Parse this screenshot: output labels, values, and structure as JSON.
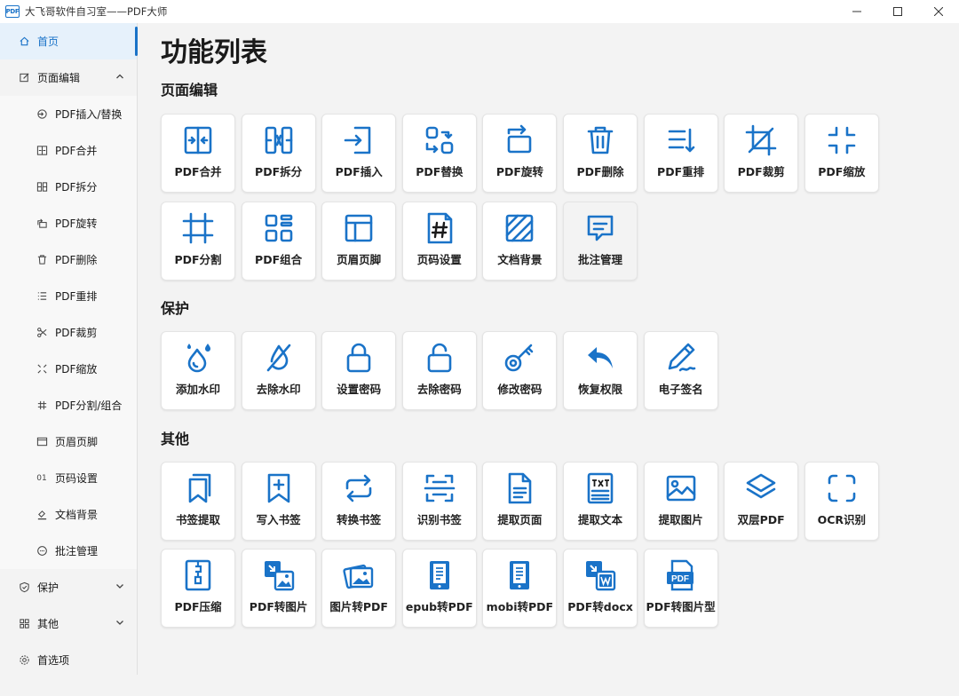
{
  "window": {
    "logo_text": "PDF",
    "title": "大飞哥软件自习室——PDF大师",
    "minimize": "—",
    "maximize": "☐",
    "close": "✕"
  },
  "sidebar": {
    "items": [
      {
        "id": "home",
        "label": "首页",
        "icon": "home-icon",
        "active": true,
        "level": 0
      },
      {
        "id": "page-edit",
        "label": "页面编辑",
        "icon": "edit-icon",
        "level": 0,
        "chevron": "up"
      },
      {
        "id": "pdf-insert-replace",
        "label": "PDF插入/替换",
        "icon": "insert-replace-icon",
        "level": 1
      },
      {
        "id": "pdf-merge",
        "label": "PDF合并",
        "icon": "merge-icon",
        "level": 1
      },
      {
        "id": "pdf-split",
        "label": "PDF拆分",
        "icon": "split-icon",
        "level": 1
      },
      {
        "id": "pdf-rotate",
        "label": "PDF旋转",
        "icon": "rotate-icon",
        "level": 1
      },
      {
        "id": "pdf-delete",
        "label": "PDF删除",
        "icon": "trash-icon",
        "level": 1
      },
      {
        "id": "pdf-reorder",
        "label": "PDF重排",
        "icon": "list-icon",
        "level": 1
      },
      {
        "id": "pdf-crop",
        "label": "PDF裁剪",
        "icon": "scissors-icon",
        "level": 1
      },
      {
        "id": "pdf-scale",
        "label": "PDF缩放",
        "icon": "shrink-icon",
        "level": 1
      },
      {
        "id": "pdf-split-combine",
        "label": "PDF分割/组合",
        "icon": "hash-icon",
        "level": 1
      },
      {
        "id": "header-footer",
        "label": "页眉页脚",
        "icon": "header-footer-icon",
        "level": 1
      },
      {
        "id": "page-number",
        "label": "页码设置",
        "icon": "page-number-icon",
        "level": 1,
        "glyph": "01"
      },
      {
        "id": "doc-background",
        "label": "文档背景",
        "icon": "paint-bucket-icon",
        "level": 1
      },
      {
        "id": "annotation",
        "label": "批注管理",
        "icon": "comment-icon",
        "level": 1
      },
      {
        "id": "protect",
        "label": "保护",
        "icon": "shield-icon",
        "level": 0,
        "chevron": "down"
      },
      {
        "id": "other",
        "label": "其他",
        "icon": "grid-icon",
        "level": 0,
        "chevron": "down"
      },
      {
        "id": "preferences",
        "label": "首选项",
        "icon": "gear-icon",
        "level": 0
      }
    ]
  },
  "main": {
    "title": "功能列表",
    "sections": [
      {
        "id": "page-edit",
        "title": "页面编辑",
        "rows": [
          [
            {
              "label": "PDF合并",
              "icon": "merge"
            },
            {
              "label": "PDF拆分",
              "icon": "split"
            },
            {
              "label": "PDF插入",
              "icon": "insert"
            },
            {
              "label": "PDF替换",
              "icon": "replace"
            },
            {
              "label": "PDF旋转",
              "icon": "rotate"
            },
            {
              "label": "PDF删除",
              "icon": "trash"
            },
            {
              "label": "PDF重排",
              "icon": "reorder"
            },
            {
              "label": "PDF裁剪",
              "icon": "crop"
            },
            {
              "label": "PDF缩放",
              "icon": "shrink"
            }
          ],
          [
            {
              "label": "PDF分割",
              "icon": "hash-frame"
            },
            {
              "label": "PDF组合",
              "icon": "combine"
            },
            {
              "label": "页眉页脚",
              "icon": "layout"
            },
            {
              "label": "页码设置",
              "icon": "page-hash"
            },
            {
              "label": "文档背景",
              "icon": "stripes"
            },
            {
              "label": "批注管理",
              "icon": "comment",
              "hover": true
            }
          ]
        ]
      },
      {
        "id": "protect",
        "title": "保护",
        "rows": [
          [
            {
              "label": "添加水印",
              "icon": "drop"
            },
            {
              "label": "去除水印",
              "icon": "drop-off"
            },
            {
              "label": "设置密码",
              "icon": "lock"
            },
            {
              "label": "去除密码",
              "icon": "unlock"
            },
            {
              "label": "修改密码",
              "icon": "key"
            },
            {
              "label": "恢复权限",
              "icon": "undo"
            },
            {
              "label": "电子签名",
              "icon": "pen"
            }
          ]
        ]
      },
      {
        "id": "other",
        "title": "其他",
        "rows": [
          [
            {
              "label": "书签提取",
              "icon": "bookmarks"
            },
            {
              "label": "写入书签",
              "icon": "bookmark-add"
            },
            {
              "label": "转换书签",
              "icon": "repeat"
            },
            {
              "label": "识别书签",
              "icon": "scan"
            },
            {
              "label": "提取页面",
              "icon": "doc-lines"
            },
            {
              "label": "提取文本",
              "icon": "txt"
            },
            {
              "label": "提取图片",
              "icon": "image"
            },
            {
              "label": "双层PDF",
              "icon": "layers"
            },
            {
              "label": "OCR识别",
              "icon": "ocr-frame"
            }
          ],
          [
            {
              "label": "PDF压缩",
              "icon": "zip"
            },
            {
              "label": "PDF转图片",
              "icon": "pdf-to-image"
            },
            {
              "label": "图片转PDF",
              "icon": "images"
            },
            {
              "label": "epub转PDF",
              "icon": "epub"
            },
            {
              "label": "mobi转PDF",
              "icon": "mobi"
            },
            {
              "label": "PDF转docx",
              "icon": "pdf-to-word"
            },
            {
              "label": "PDF转图片型",
              "icon": "pdf-badge",
              "badge": "PDF"
            }
          ]
        ]
      }
    ]
  },
  "colors": {
    "accent": "#1a73c8",
    "sidebar_active_bg": "#e6f1fb"
  }
}
